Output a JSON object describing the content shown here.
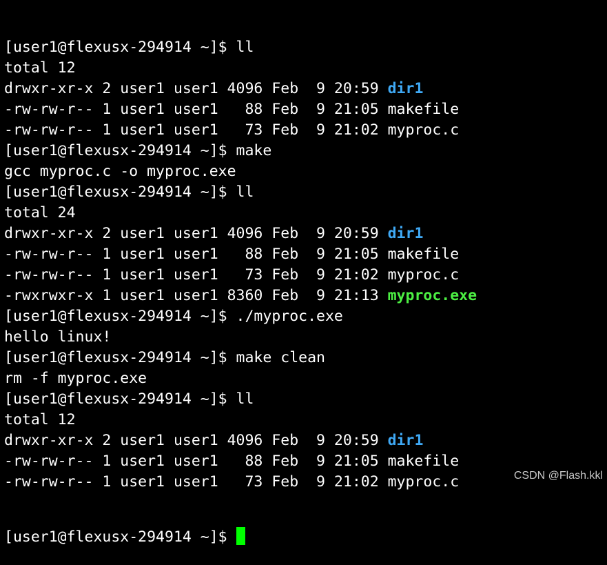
{
  "colors": {
    "background": "#000000",
    "text": "#ffffff",
    "directory": "#3fa9f5",
    "executable": "#4cf043",
    "cursor": "#00ff00"
  },
  "terminal": {
    "lines": [
      {
        "kind": "prompt",
        "segments": [
          {
            "text": "[user1@flexusx-294914 ~]$ ll",
            "style": ""
          }
        ]
      },
      {
        "kind": "output",
        "segments": [
          {
            "text": "total 12",
            "style": ""
          }
        ]
      },
      {
        "kind": "listing",
        "segments": [
          {
            "text": "drwxr-xr-x 2 user1 user1 4096 Feb  9 20:59 ",
            "style": ""
          },
          {
            "text": "dir1",
            "style": "dir"
          }
        ]
      },
      {
        "kind": "listing",
        "segments": [
          {
            "text": "-rw-rw-r-- 1 user1 user1   88 Feb  9 21:05 makefile",
            "style": ""
          }
        ]
      },
      {
        "kind": "listing",
        "segments": [
          {
            "text": "-rw-rw-r-- 1 user1 user1   73 Feb  9 21:02 myproc.c",
            "style": ""
          }
        ]
      },
      {
        "kind": "prompt",
        "segments": [
          {
            "text": "[user1@flexusx-294914 ~]$ make",
            "style": ""
          }
        ]
      },
      {
        "kind": "output",
        "segments": [
          {
            "text": "gcc myproc.c -o myproc.exe",
            "style": ""
          }
        ]
      },
      {
        "kind": "prompt",
        "segments": [
          {
            "text": "[user1@flexusx-294914 ~]$ ll",
            "style": ""
          }
        ]
      },
      {
        "kind": "output",
        "segments": [
          {
            "text": "total 24",
            "style": ""
          }
        ]
      },
      {
        "kind": "listing",
        "segments": [
          {
            "text": "drwxr-xr-x 2 user1 user1 4096 Feb  9 20:59 ",
            "style": ""
          },
          {
            "text": "dir1",
            "style": "dir"
          }
        ]
      },
      {
        "kind": "listing",
        "segments": [
          {
            "text": "-rw-rw-r-- 1 user1 user1   88 Feb  9 21:05 makefile",
            "style": ""
          }
        ]
      },
      {
        "kind": "listing",
        "segments": [
          {
            "text": "-rw-rw-r-- 1 user1 user1   73 Feb  9 21:02 myproc.c",
            "style": ""
          }
        ]
      },
      {
        "kind": "listing",
        "segments": [
          {
            "text": "-rwxrwxr-x 1 user1 user1 8360 Feb  9 21:13 ",
            "style": ""
          },
          {
            "text": "myproc.exe",
            "style": "exe"
          }
        ]
      },
      {
        "kind": "prompt",
        "segments": [
          {
            "text": "[user1@flexusx-294914 ~]$ ./myproc.exe",
            "style": ""
          }
        ]
      },
      {
        "kind": "output",
        "segments": [
          {
            "text": "hello linux!",
            "style": ""
          }
        ]
      },
      {
        "kind": "prompt",
        "segments": [
          {
            "text": "[user1@flexusx-294914 ~]$ make clean",
            "style": ""
          }
        ]
      },
      {
        "kind": "output",
        "segments": [
          {
            "text": "rm -f myproc.exe",
            "style": ""
          }
        ]
      },
      {
        "kind": "prompt",
        "segments": [
          {
            "text": "[user1@flexusx-294914 ~]$ ll",
            "style": ""
          }
        ]
      },
      {
        "kind": "output",
        "segments": [
          {
            "text": "total 12",
            "style": ""
          }
        ]
      },
      {
        "kind": "listing",
        "segments": [
          {
            "text": "drwxr-xr-x 2 user1 user1 4096 Feb  9 20:59 ",
            "style": ""
          },
          {
            "text": "dir1",
            "style": "dir"
          }
        ]
      },
      {
        "kind": "listing",
        "segments": [
          {
            "text": "-rw-rw-r-- 1 user1 user1   88 Feb  9 21:05 makefile",
            "style": ""
          }
        ]
      },
      {
        "kind": "listing",
        "segments": [
          {
            "text": "-rw-rw-r-- 1 user1 user1   73 Feb  9 21:02 myproc.c",
            "style": ""
          }
        ]
      }
    ],
    "current_prompt": "[user1@flexusx-294914 ~]$ "
  },
  "watermark": "CSDN @Flash.kkl"
}
